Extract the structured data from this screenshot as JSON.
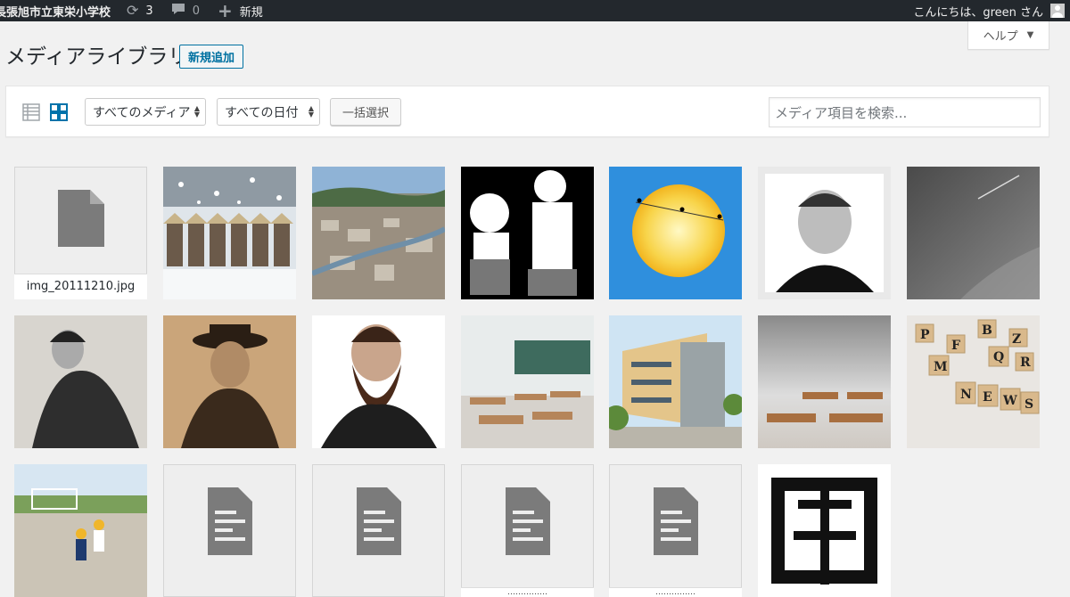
{
  "adminbar": {
    "site_name": "長張旭市立東栄小学校",
    "updates_count": "3",
    "comments_count": "0",
    "new_label": "新規",
    "greeting": "こんにちは、green さん"
  },
  "help": {
    "label": "ヘルプ",
    "arrow": "▼"
  },
  "page": {
    "title": "メディアライブラリ",
    "add_new": "新規追加"
  },
  "toolbar": {
    "filter_type": "すべてのメディア",
    "filter_date": "すべての日付",
    "bulk_select": "一括選択",
    "search_placeholder": "メディア項目を検索..."
  },
  "media": [
    {
      "name": "file-placeholder",
      "label": "img_20111210.jpg"
    },
    {
      "name": "snowy-figures"
    },
    {
      "name": "town-aerial"
    },
    {
      "name": "doctor-child-illustration"
    },
    {
      "name": "sun-diagram"
    },
    {
      "name": "portrait-man-glasses"
    },
    {
      "name": "night-sky-comet"
    },
    {
      "name": "portrait-woman"
    },
    {
      "name": "portrait-hat-man"
    },
    {
      "name": "portrait-bearded-man"
    },
    {
      "name": "classroom"
    },
    {
      "name": "school-building"
    },
    {
      "name": "classroom-desks"
    },
    {
      "name": "letter-blocks-news"
    },
    {
      "name": "schoolyard-children"
    },
    {
      "name": "document-1"
    },
    {
      "name": "document-2"
    },
    {
      "name": "document-3",
      "label": "……………"
    },
    {
      "name": "document-4",
      "label": "……………"
    },
    {
      "name": "school-emblem"
    }
  ]
}
